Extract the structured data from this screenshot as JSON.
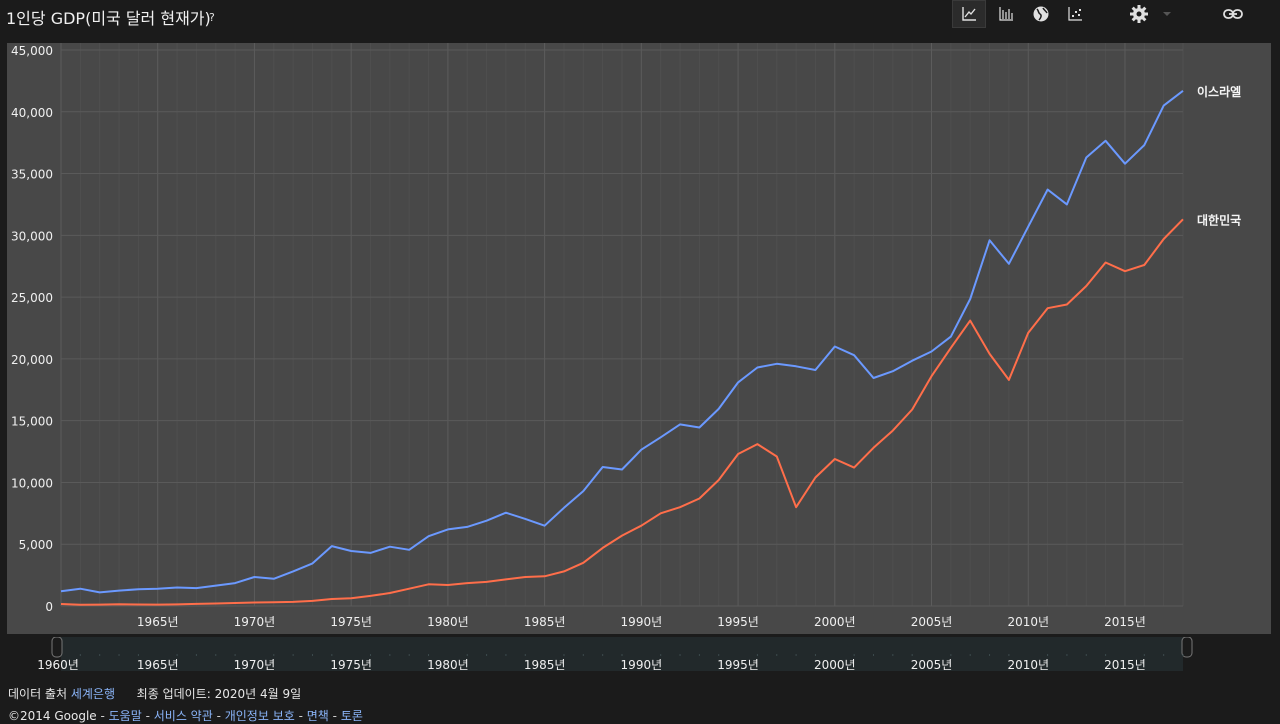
{
  "header": {
    "title": "1인당 GDP(미국 달러 현재가)",
    "help": "?"
  },
  "toolbar": {
    "icons": [
      "line-chart-icon",
      "bar-chart-icon",
      "globe-map-icon",
      "scatter-chart-icon",
      "gear-icon",
      "chevron-down-icon",
      "link-icon"
    ],
    "active": "line-chart-icon"
  },
  "colors": {
    "israel": "#6b99ff",
    "korea": "#ff6e4a",
    "plot_bg": "#484848",
    "grid": "#5a5a5a"
  },
  "chart_data": {
    "type": "line",
    "title": "1인당 GDP(미국 달러 현재가)",
    "xlabel": "",
    "ylabel": "",
    "x": [
      1960,
      1961,
      1962,
      1963,
      1964,
      1965,
      1966,
      1967,
      1968,
      1969,
      1970,
      1971,
      1972,
      1973,
      1974,
      1975,
      1976,
      1977,
      1978,
      1979,
      1980,
      1981,
      1982,
      1983,
      1984,
      1985,
      1986,
      1987,
      1988,
      1989,
      1990,
      1991,
      1992,
      1993,
      1994,
      1995,
      1996,
      1997,
      1998,
      1999,
      2000,
      2001,
      2002,
      2003,
      2004,
      2005,
      2006,
      2007,
      2008,
      2009,
      2010,
      2011,
      2012,
      2013,
      2014,
      2015,
      2016,
      2017,
      2018
    ],
    "xlim": [
      1960,
      2018
    ],
    "ylim": [
      0,
      45000
    ],
    "y_ticks": [
      "0",
      "5,000",
      "10,000",
      "15,000",
      "20,000",
      "25,000",
      "30,000",
      "35,000",
      "40,000",
      "45,000"
    ],
    "x_ticks": [
      "1965년",
      "1970년",
      "1975년",
      "1980년",
      "1985년",
      "1990년",
      "1995년",
      "2000년",
      "2005년",
      "2010년",
      "2015년"
    ],
    "grid": true,
    "legend": "line-end labels",
    "series": [
      {
        "name": "이스라엘",
        "values": [
          1200,
          1400,
          1100,
          1250,
          1350,
          1400,
          1500,
          1450,
          1650,
          1850,
          2350,
          2200,
          2800,
          3450,
          4850,
          4450,
          4300,
          4800,
          4550,
          5650,
          6200,
          6400,
          6900,
          7550,
          7050,
          6500,
          7950,
          9300,
          11250,
          11050,
          12650,
          13650,
          14700,
          14450,
          15950,
          18100,
          19300,
          19600,
          19400,
          19100,
          21000,
          20300,
          18450,
          19000,
          19850,
          20600,
          21800,
          24850,
          29600,
          27700,
          30700,
          33700,
          32500,
          36300,
          37650,
          35800,
          37300,
          40500,
          41700
        ]
      },
      {
        "name": "대한민국",
        "values": [
          160,
          100,
          110,
          140,
          120,
          110,
          130,
          170,
          200,
          240,
          280,
          300,
          330,
          410,
          570,
          620,
          820,
          1050,
          1400,
          1760,
          1700,
          1850,
          1950,
          2150,
          2350,
          2400,
          2800,
          3500,
          4700,
          5700,
          6500,
          7500,
          8000,
          8700,
          10200,
          12300,
          13100,
          12100,
          8000,
          10400,
          11900,
          11200,
          12800,
          14200,
          15900,
          18600,
          20900,
          23100,
          20400,
          18300,
          22100,
          24100,
          24400,
          25900,
          27800,
          27100,
          27600,
          29700,
          31300
        ]
      }
    ]
  },
  "timeline": {
    "labels": [
      "1960년",
      "1965년",
      "1970년",
      "1975년",
      "1980년",
      "1985년",
      "1990년",
      "1995년",
      "2000년",
      "2005년",
      "2010년",
      "2015년"
    ]
  },
  "footer": {
    "source_label": "데이터 출처",
    "source_link": "세계은행",
    "updated": "최종 업데이트: 2020년 4월 9일",
    "copyright": "©2014 Google",
    "links": [
      "도움말",
      "서비스 약관",
      "개인정보 보호",
      "면책",
      "토론"
    ],
    "separator": " - "
  }
}
